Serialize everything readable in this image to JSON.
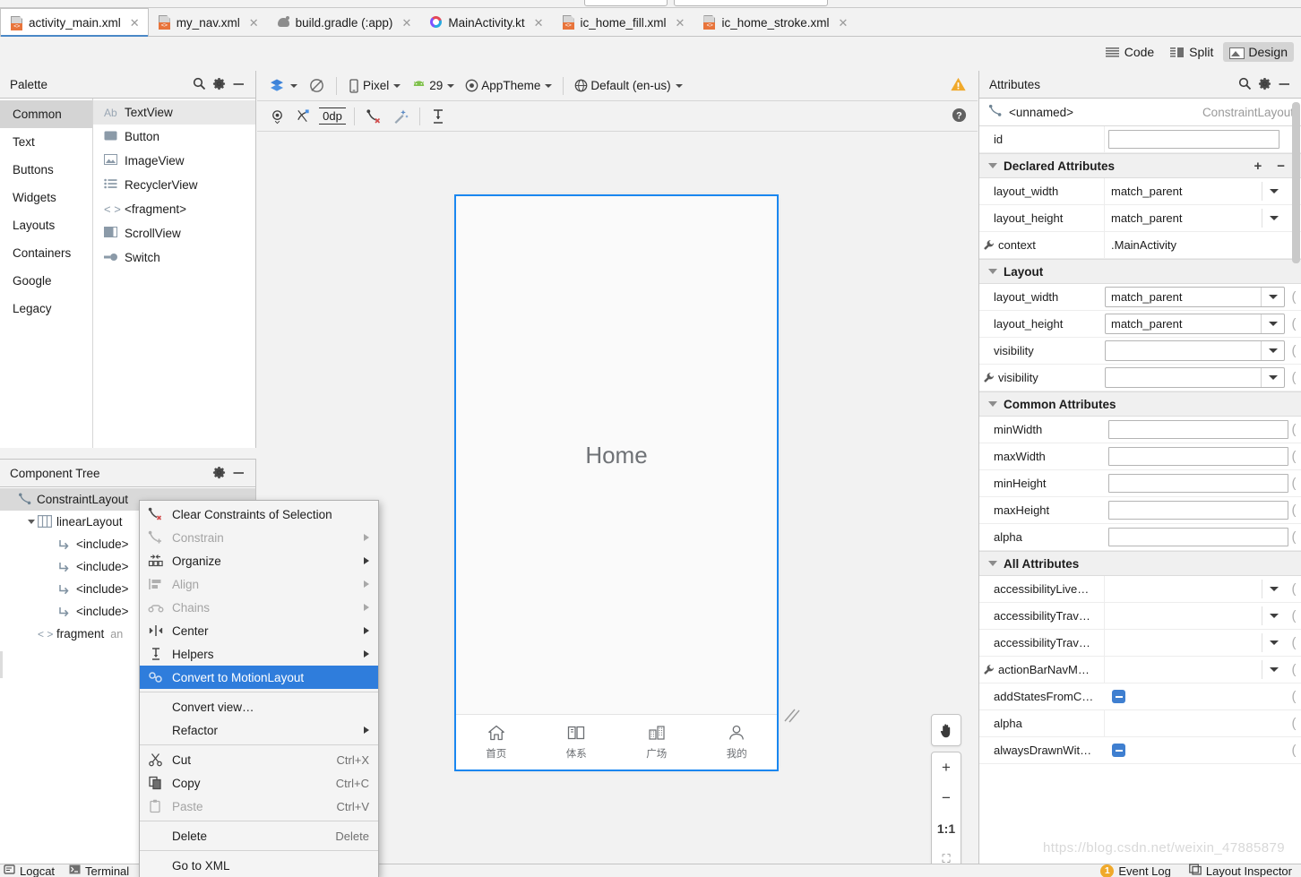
{
  "tabs": [
    {
      "label": "activity_main.xml",
      "icon": "xml-file-icon",
      "active": true
    },
    {
      "label": "my_nav.xml",
      "icon": "xml-file-icon",
      "active": false
    },
    {
      "label": "build.gradle (:app)",
      "icon": "gradle-file-icon",
      "active": false
    },
    {
      "label": "MainActivity.kt",
      "icon": "kotlin-file-icon",
      "active": false
    },
    {
      "label": "ic_home_fill.xml",
      "icon": "xml-file-icon",
      "active": false
    },
    {
      "label": "ic_home_stroke.xml",
      "icon": "xml-file-icon",
      "active": false
    }
  ],
  "view_modes": [
    {
      "label": "Code",
      "icon": "code-view-icon",
      "selected": false
    },
    {
      "label": "Split",
      "icon": "split-view-icon",
      "selected": false
    },
    {
      "label": "Design",
      "icon": "design-view-icon",
      "selected": true
    }
  ],
  "palette": {
    "title": "Palette",
    "categories": [
      {
        "label": "Common",
        "selected": true
      },
      {
        "label": "Text",
        "selected": false
      },
      {
        "label": "Buttons",
        "selected": false
      },
      {
        "label": "Widgets",
        "selected": false
      },
      {
        "label": "Layouts",
        "selected": false
      },
      {
        "label": "Containers",
        "selected": false
      },
      {
        "label": "Google",
        "selected": false
      },
      {
        "label": "Legacy",
        "selected": false
      }
    ],
    "items": [
      {
        "label": "TextView",
        "icon": "textview-icon",
        "selected": true
      },
      {
        "label": "Button",
        "icon": "button-icon",
        "selected": false
      },
      {
        "label": "ImageView",
        "icon": "imageview-icon",
        "selected": false
      },
      {
        "label": "RecyclerView",
        "icon": "recyclerview-icon",
        "selected": false
      },
      {
        "label": "<fragment>",
        "icon": "fragment-icon",
        "selected": false
      },
      {
        "label": "ScrollView",
        "icon": "scrollview-icon",
        "selected": false
      },
      {
        "label": "Switch",
        "icon": "switch-icon",
        "selected": false
      }
    ]
  },
  "component_tree": {
    "title": "Component Tree",
    "nodes": [
      {
        "label": "ConstraintLayout",
        "indent": 0,
        "icon": "constraintlayout-icon",
        "twisty": "none",
        "selected": true,
        "sub": ""
      },
      {
        "label": "linearLayout",
        "indent": 1,
        "icon": "linearlayout-icon",
        "twisty": "open",
        "selected": false,
        "sub": ""
      },
      {
        "label": "<include>",
        "indent": 2,
        "icon": "include-icon",
        "twisty": "none",
        "selected": false,
        "sub": ""
      },
      {
        "label": "<include>",
        "indent": 2,
        "icon": "include-icon",
        "twisty": "none",
        "selected": false,
        "sub": ""
      },
      {
        "label": "<include>",
        "indent": 2,
        "icon": "include-icon",
        "twisty": "none",
        "selected": false,
        "sub": ""
      },
      {
        "label": "<include>",
        "indent": 2,
        "icon": "include-icon",
        "twisty": "none",
        "selected": false,
        "sub": ""
      },
      {
        "label": "fragment",
        "indent": 1,
        "icon": "fragment-icon",
        "twisty": "none",
        "selected": false,
        "sub": "an"
      }
    ]
  },
  "design_toolbar": {
    "device": "Pixel",
    "api_level": "29",
    "theme": "AppTheme",
    "locale": "Default (en-us)",
    "margin_value": "0dp",
    "warning_icon": "warning-icon",
    "help_icon": "help-icon"
  },
  "preview": {
    "screen_label": "Home",
    "bottom_nav": [
      {
        "label": "首页",
        "icon": "home-icon"
      },
      {
        "label": "体系",
        "icon": "book-icon"
      },
      {
        "label": "广场",
        "icon": "building-icon"
      },
      {
        "label": "我的",
        "icon": "person-icon"
      }
    ]
  },
  "zoom_controls": [
    {
      "label": "✋",
      "name": "pan-tool-button"
    },
    {
      "label": "+",
      "name": "zoom-in-button"
    },
    {
      "label": "−",
      "name": "zoom-out-button"
    },
    {
      "label": "1:1",
      "name": "zoom-actual-size-button"
    },
    {
      "label": "⛶",
      "name": "zoom-to-fit-button"
    }
  ],
  "attributes": {
    "title": "Attributes",
    "selection_name": "<unnamed>",
    "selection_type": "ConstraintLayout",
    "id_label": "id",
    "id_value": "",
    "sections": [
      {
        "title": "Declared Attributes",
        "has_add_remove": true,
        "rows": [
          {
            "label": "layout_width",
            "value": "match_parent",
            "kind": "combo-flat",
            "wrench": false
          },
          {
            "label": "layout_height",
            "value": "match_parent",
            "kind": "combo-flat",
            "wrench": false
          },
          {
            "label": "context",
            "value": ".MainActivity",
            "kind": "plain",
            "wrench": true
          }
        ]
      },
      {
        "title": "Layout",
        "has_add_remove": false,
        "rows": [
          {
            "label": "layout_width",
            "value": "match_parent",
            "kind": "combo-box",
            "wrench": false
          },
          {
            "label": "layout_height",
            "value": "match_parent",
            "kind": "combo-box",
            "wrench": false
          },
          {
            "label": "visibility",
            "value": "",
            "kind": "combo-box",
            "wrench": false
          },
          {
            "label": "visibility",
            "value": "",
            "kind": "combo-box",
            "wrench": true
          }
        ]
      },
      {
        "title": "Common Attributes",
        "has_add_remove": false,
        "rows": [
          {
            "label": "minWidth",
            "value": "",
            "kind": "textbox",
            "wrench": false
          },
          {
            "label": "maxWidth",
            "value": "",
            "kind": "textbox",
            "wrench": false
          },
          {
            "label": "minHeight",
            "value": "",
            "kind": "textbox",
            "wrench": false
          },
          {
            "label": "maxHeight",
            "value": "",
            "kind": "textbox",
            "wrench": false
          },
          {
            "label": "alpha",
            "value": "",
            "kind": "textbox",
            "wrench": false
          }
        ]
      },
      {
        "title": "All Attributes",
        "has_add_remove": false,
        "rows": [
          {
            "label": "accessibilityLive…",
            "value": "",
            "kind": "combo-flat",
            "wrench": false
          },
          {
            "label": "accessibilityTrav…",
            "value": "",
            "kind": "combo-flat",
            "wrench": false
          },
          {
            "label": "accessibilityTrav…",
            "value": "",
            "kind": "combo-flat",
            "wrench": false
          },
          {
            "label": "actionBarNavM…",
            "value": "",
            "kind": "combo-flat",
            "wrench": true
          },
          {
            "label": "addStatesFromC…",
            "value": "",
            "kind": "checkbox",
            "wrench": false
          },
          {
            "label": "alpha",
            "value": "",
            "kind": "plain",
            "wrench": false
          },
          {
            "label": "alwaysDrawnWit…",
            "value": "",
            "kind": "checkbox",
            "wrench": false
          }
        ]
      }
    ]
  },
  "context_menu": {
    "items": [
      {
        "label": "Clear Constraints of Selection",
        "icon": "clear-constraints-icon",
        "state": "normal",
        "submenu": false,
        "accel": ""
      },
      {
        "label": "Constrain",
        "icon": "constrain-icon",
        "state": "disabled",
        "submenu": true,
        "accel": ""
      },
      {
        "label": "Organize",
        "icon": "organize-icon",
        "state": "normal",
        "submenu": true,
        "accel": ""
      },
      {
        "label": "Align",
        "icon": "align-icon",
        "state": "disabled",
        "submenu": true,
        "accel": ""
      },
      {
        "label": "Chains",
        "icon": "chains-icon",
        "state": "disabled",
        "submenu": true,
        "accel": ""
      },
      {
        "label": "Center",
        "icon": "center-icon",
        "state": "normal",
        "submenu": true,
        "accel": ""
      },
      {
        "label": "Helpers",
        "icon": "helpers-icon",
        "state": "normal",
        "submenu": true,
        "accel": ""
      },
      {
        "label": "Convert to MotionLayout",
        "icon": "motionlayout-icon",
        "state": "highlight",
        "submenu": false,
        "accel": ""
      },
      {
        "separator": true
      },
      {
        "label": "Convert view…",
        "icon": "",
        "state": "normal",
        "submenu": false,
        "accel": ""
      },
      {
        "label": "Refactor",
        "icon": "",
        "state": "normal",
        "submenu": true,
        "accel": ""
      },
      {
        "separator": true
      },
      {
        "label": "Cut",
        "icon": "cut-icon",
        "state": "normal",
        "submenu": false,
        "accel": "Ctrl+X"
      },
      {
        "label": "Copy",
        "icon": "copy-icon",
        "state": "normal",
        "submenu": false,
        "accel": "Ctrl+C"
      },
      {
        "label": "Paste",
        "icon": "paste-icon",
        "state": "disabled",
        "submenu": false,
        "accel": "Ctrl+V"
      },
      {
        "separator": true
      },
      {
        "label": "Delete",
        "icon": "",
        "state": "normal",
        "submenu": false,
        "accel": "Delete"
      },
      {
        "separator": true
      },
      {
        "label": "Go to XML",
        "icon": "",
        "state": "normal",
        "submenu": false,
        "accel": ""
      }
    ]
  },
  "statusbar": {
    "left_items": [
      {
        "label": "Logcat",
        "icon": "logcat-icon"
      },
      {
        "label": "Terminal",
        "icon": "terminal-icon"
      }
    ],
    "right_items": [
      {
        "label": "Event Log",
        "icon": "event-log-badge",
        "badge": "1"
      },
      {
        "label": "Layout Inspector",
        "icon": "layout-inspector-icon",
        "badge": ""
      }
    ]
  },
  "watermark": "https://blog.csdn.net/weixin_47885879",
  "colors": {
    "selection_blue": "#1a87f0",
    "menu_highlight": "#2f7ddc",
    "warning_orange": "#f0a92b",
    "accent_orange": "#e8743b"
  }
}
